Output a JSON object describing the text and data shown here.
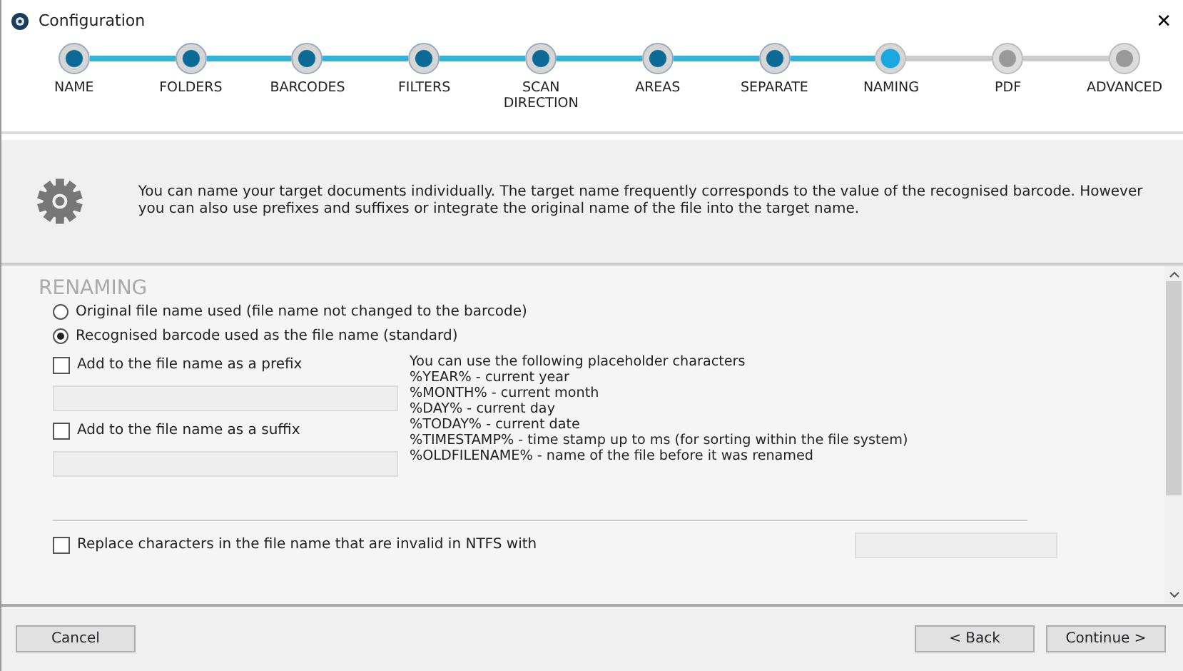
{
  "window": {
    "title": "Configuration",
    "close": "✕"
  },
  "steps": [
    {
      "label": "NAME",
      "completed": true,
      "selected": false
    },
    {
      "label": "FOLDERS",
      "completed": true,
      "selected": false
    },
    {
      "label": "BARCODES",
      "completed": true,
      "selected": false
    },
    {
      "label": "FILTERS",
      "completed": true,
      "selected": false
    },
    {
      "label": "SCAN DIRECTION",
      "completed": true,
      "selected": false
    },
    {
      "label": "AREAS",
      "completed": true,
      "selected": false
    },
    {
      "label": "SEPARATE",
      "completed": true,
      "selected": false
    },
    {
      "label": "NAMING",
      "completed": false,
      "selected": true
    },
    {
      "label": "PDF",
      "completed": false,
      "selected": false
    },
    {
      "label": "ADVANCED",
      "completed": false,
      "selected": false
    }
  ],
  "info": {
    "text": "You can name your target documents individually. The target name frequently corresponds to the value of the recognised barcode. However you can also use prefixes and suffixes or integrate the original name of the file into the target name."
  },
  "section": {
    "title": "RENAMING",
    "radios": [
      {
        "label": "Original file name used (file name not changed to the barcode)",
        "selected": false
      },
      {
        "label": "Recognised barcode used as the file name (standard)",
        "selected": true
      }
    ],
    "affixes": [
      {
        "label": "Add to the file name as a prefix",
        "checked": false
      },
      {
        "label": "Add to the file name as a suffix",
        "checked": false
      }
    ],
    "placeholder_help": [
      "You can use the following placeholder characters",
      "%YEAR% - current year",
      "%MONTH% - current month",
      "%DAY% - current day",
      "%TODAY% - current date",
      "%TIMESTAMP% - time stamp up to ms (for sorting within the file system)",
      "%OLDFILENAME% - name of the file before it was renamed"
    ],
    "replace": {
      "label": "Replace characters in the file name that are invalid in NTFS with",
      "checked": false
    }
  },
  "buttons": {
    "cancel": "Cancel",
    "back": "< Back",
    "continue": "Continue >"
  }
}
